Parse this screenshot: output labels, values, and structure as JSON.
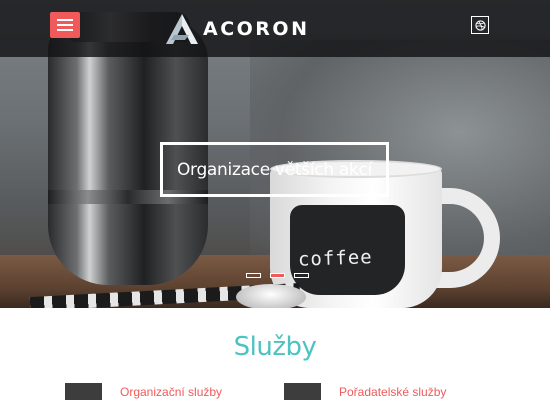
{
  "navbar": {
    "menu_icon": "hamburger-icon",
    "logo_text": "ACORON",
    "social_icon": "dribbble-icon"
  },
  "hero": {
    "caption": "Organizace větších akcí",
    "cup_text": "coffee",
    "slides_total": 3,
    "active_slide": 2
  },
  "services": {
    "heading": "Služby",
    "items": [
      {
        "title": "Organizační služby"
      },
      {
        "title": "Pořadatelské služby"
      }
    ]
  },
  "colors": {
    "accent": "#f05a5b",
    "heading": "#4dc3c0",
    "navbar": "#141416"
  }
}
